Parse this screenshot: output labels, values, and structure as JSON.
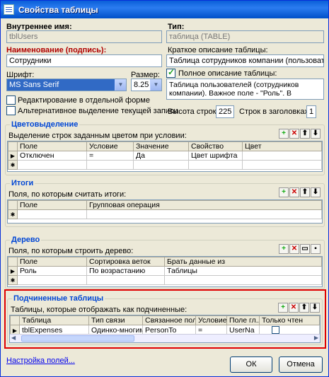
{
  "window": {
    "title": "Свойства таблицы"
  },
  "internal_name": {
    "label": "Внутреннее имя:",
    "value": "tblUsers"
  },
  "type": {
    "label": "Тип:",
    "value": "таблица (TABLE)"
  },
  "caption": {
    "label": "Наименование (подпись):",
    "value": "Сотрудники"
  },
  "short_desc": {
    "label": "Краткое описание таблицы:",
    "value": "Таблица сотрудников компании (пользователей"
  },
  "font": {
    "label": "Шрифт:",
    "value": "MS Sans Serif"
  },
  "size": {
    "label": "Размер:",
    "value": "8.25"
  },
  "full_desc": {
    "label": "Полное описание таблицы:",
    "value": "Таблица пользователей (сотрудников компании). Важное поле - \"Роль\". В"
  },
  "edit_separate": {
    "label": "Редактирование в отдельной форме"
  },
  "alt_select": {
    "label": "Альтернативное выделение текущей записи"
  },
  "row_height": {
    "label": "Высота строк:",
    "value": "225"
  },
  "header_rows": {
    "label": "Строк в заголовках:",
    "value": "1"
  },
  "coloring": {
    "title": "Цветовыделение",
    "desc": "Выделение строк заданным цветом при условии:",
    "columns": [
      "Поле",
      "Условие",
      "Значение",
      "Свойство",
      "Цвет"
    ],
    "rows": [
      [
        "Отключен",
        "=",
        "Да",
        "Цвет шрифта",
        ""
      ]
    ]
  },
  "totals": {
    "title": "Итоги",
    "desc": "Поля, по которым считать итоги:",
    "columns": [
      "Поле",
      "Групповая операция"
    ]
  },
  "tree": {
    "title": "Дерево",
    "desc": "Поля, по которым строить дерево:",
    "columns": [
      "Поле",
      "Сортировка веток",
      "Брать данные из"
    ],
    "rows": [
      [
        "Роль",
        "По возрастанию",
        "Таблицы"
      ]
    ]
  },
  "subtables": {
    "title": "Подчиненные таблицы",
    "desc": "Таблицы, которые отображать как подчиненные:",
    "columns": [
      "Таблица",
      "Тип связи",
      "Связанное поле",
      "Условие",
      "Поле гл...",
      "Только чтен"
    ],
    "rows": [
      [
        "tblExpenses",
        "Одинко-многим",
        "PersonTo",
        "=",
        "UserNa",
        ""
      ]
    ]
  },
  "footer": {
    "link": "Настройка полей...",
    "ok": "ОК",
    "cancel": "Отмена"
  },
  "toolbar": {
    "add": "+",
    "del": "✕",
    "up": "⬆",
    "down": "⬇",
    "open": "▭",
    "save": "▪"
  }
}
